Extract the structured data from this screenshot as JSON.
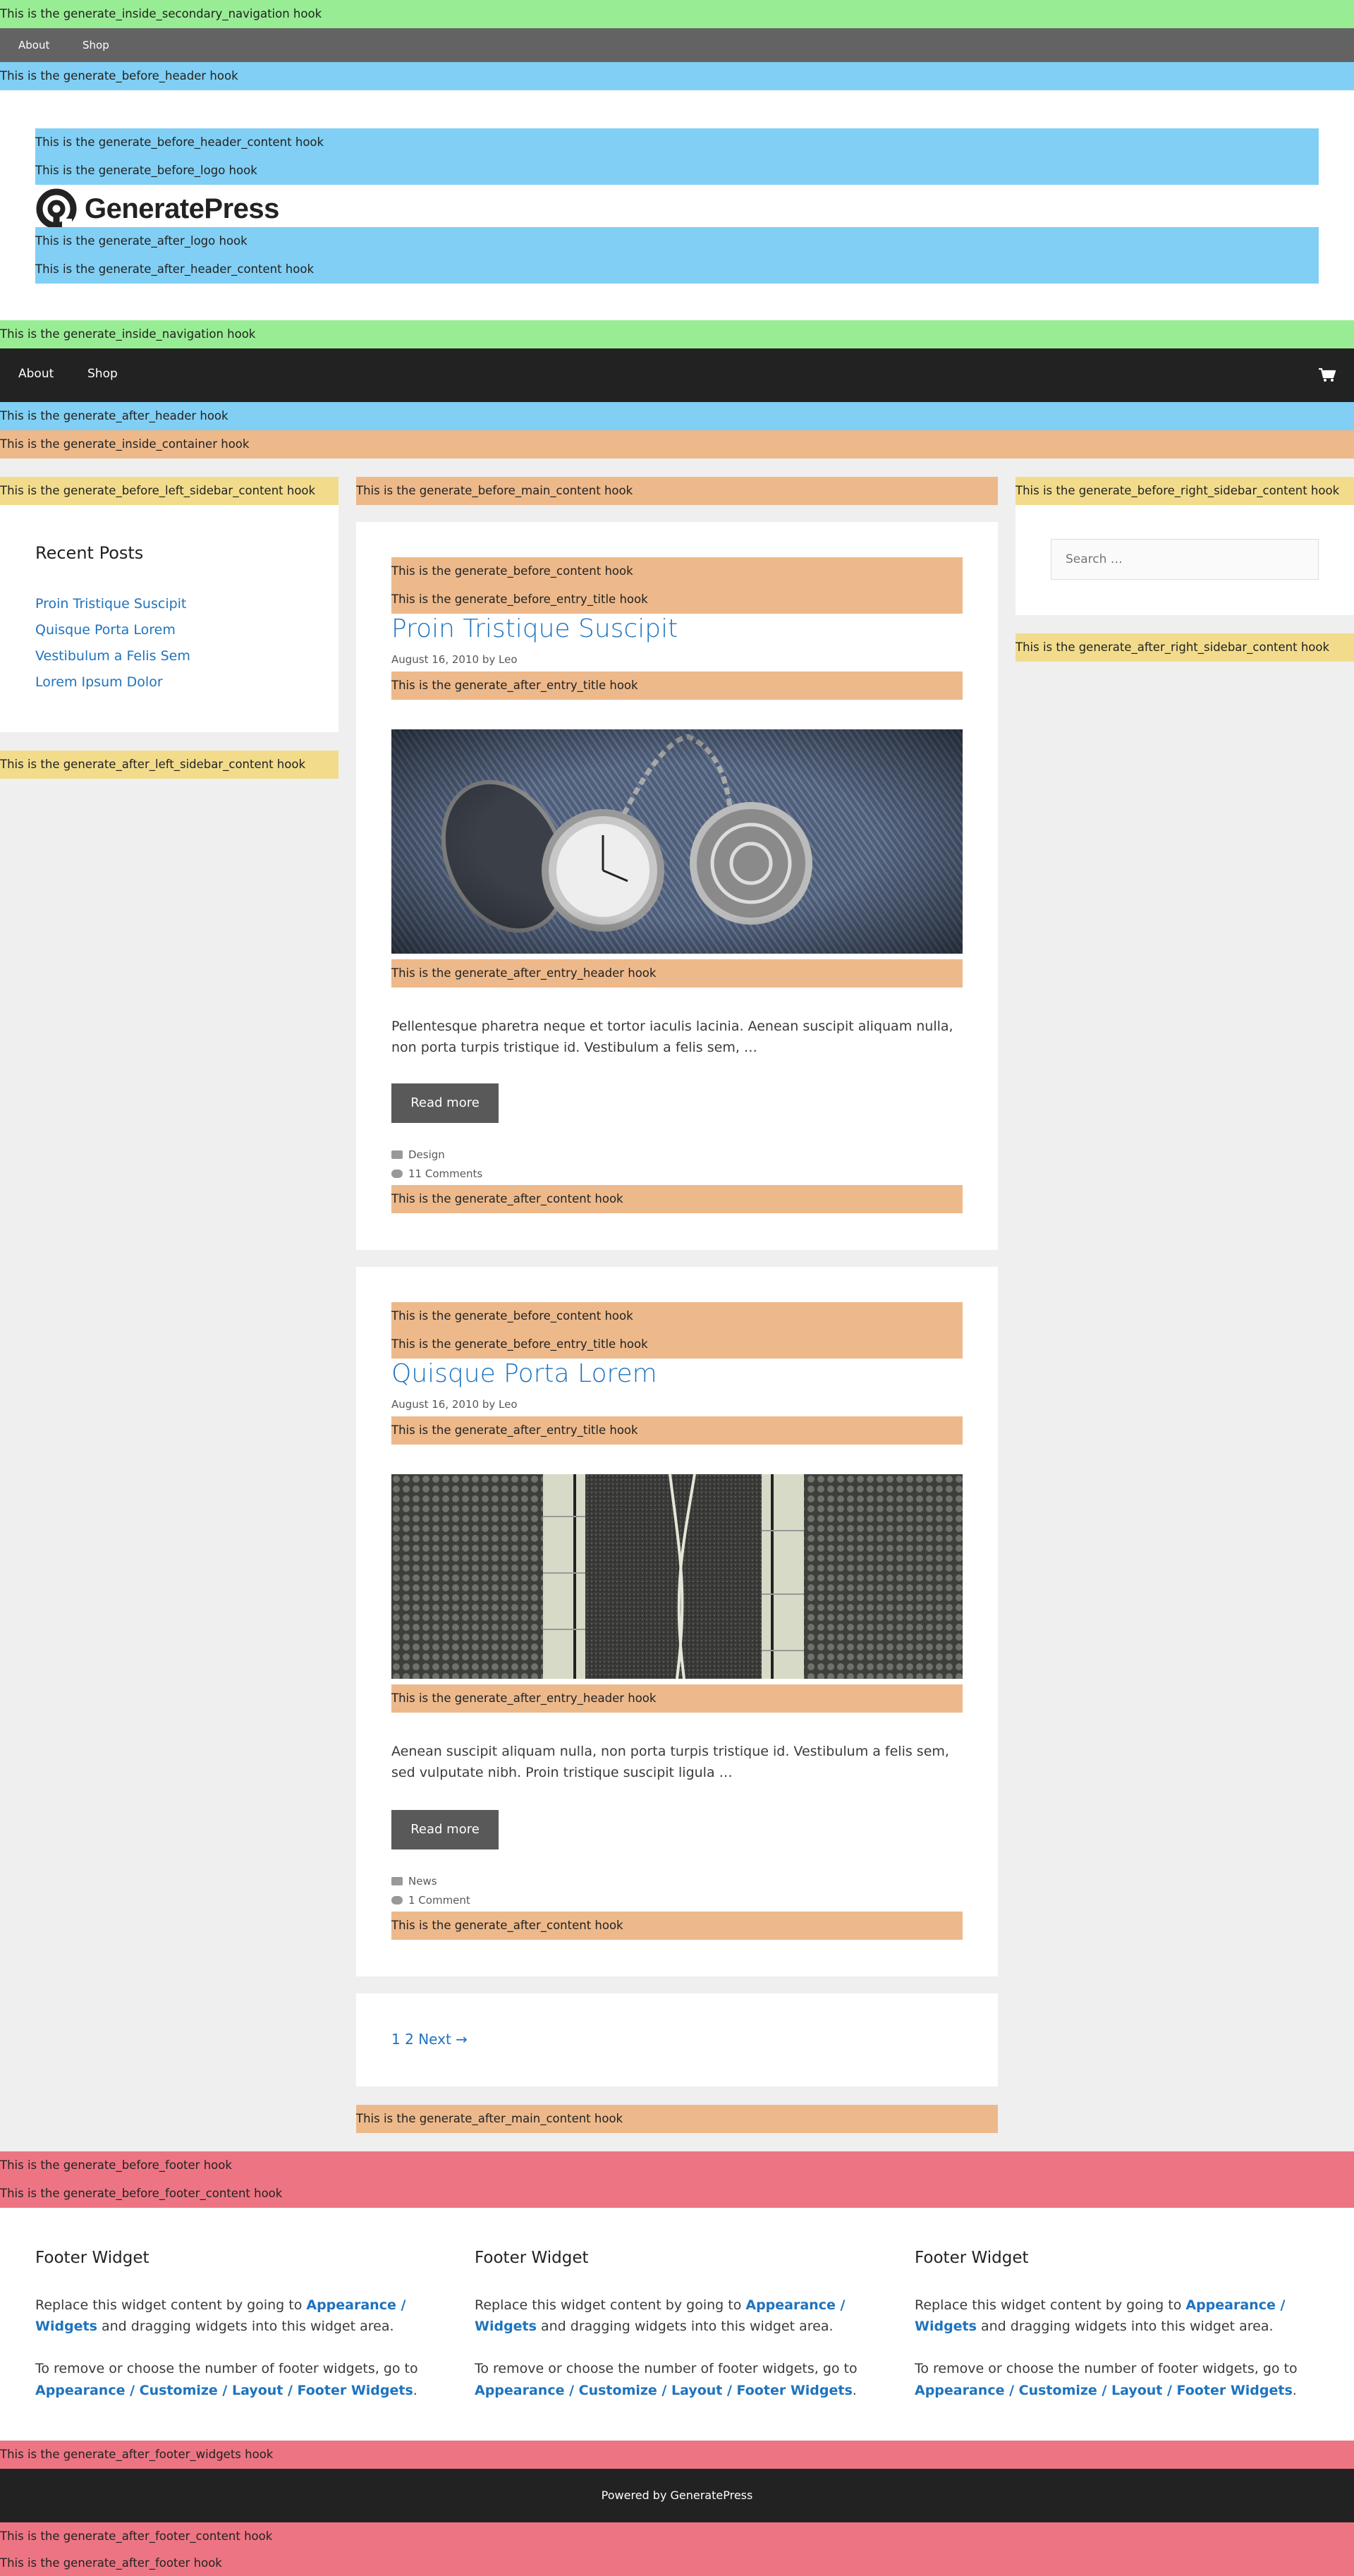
{
  "hooks": {
    "inside_secondary_navigation": "This is the generate_inside_secondary_navigation hook",
    "before_header": "This is the generate_before_header hook",
    "before_header_content": "This is the generate_before_header_content hook",
    "before_logo": "This is the generate_before_logo hook",
    "after_logo": "This is the generate_after_logo hook",
    "after_header_content": "This is the generate_after_header_content hook",
    "inside_navigation": "This is the generate_inside_navigation hook",
    "after_header": "This is the generate_after_header hook",
    "inside_container": "This is the generate_inside_container hook",
    "before_left_sidebar_content": "This is the generate_before_left_sidebar_content hook",
    "after_left_sidebar_content": "This is the generate_after_left_sidebar_content hook",
    "before_main_content": "This is the generate_before_main_content hook",
    "before_right_sidebar_content": "This is the generate_before_right_sidebar_content hook",
    "after_right_sidebar_content": "This is the generate_after_right_sidebar_content hook",
    "before_content": "This is the generate_before_content hook",
    "before_entry_title": "This is the generate_before_entry_title hook",
    "after_entry_title": "This is the generate_after_entry_title hook",
    "after_entry_header": "This is the generate_after_entry_header hook",
    "after_content": "This is the generate_after_content hook",
    "after_main_content": "This is the generate_after_main_content hook",
    "before_footer": "This is the generate_before_footer hook",
    "before_footer_content": "This is the generate_before_footer_content hook",
    "after_footer_widgets": "This is the generate_after_footer_widgets hook",
    "after_footer_content": "This is the generate_after_footer_content hook",
    "after_footer": "This is the generate_after_footer hook"
  },
  "secondary_nav": {
    "items": [
      "About",
      "Shop"
    ]
  },
  "logo": {
    "text": "GeneratePress"
  },
  "main_nav": {
    "items": [
      "About",
      "Shop"
    ],
    "cart_icon": "cart-icon"
  },
  "left_sidebar": {
    "title": "Recent Posts",
    "posts": [
      "Proin Tristique Suscipit",
      "Quisque Porta Lorem",
      "Vestibulum a Felis Sem",
      "Lorem Ipsum Dolor"
    ]
  },
  "right_sidebar": {
    "search_placeholder": "Search …"
  },
  "posts": [
    {
      "title": "Proin Tristique Suscipit",
      "date": "August 16, 2010",
      "by": "by",
      "author": "Leo",
      "excerpt": "Pellentesque pharetra neque et tortor iaculis lacinia. Aenean suscipit aliquam nulla, non porta turpis tristique id. Vestibulum a felis sem, …",
      "read_more": "Read more",
      "category": "Design",
      "comments": "11 Comments"
    },
    {
      "title": "Quisque Porta Lorem",
      "date": "August 16, 2010",
      "by": "by",
      "author": "Leo",
      "excerpt": "Aenean suscipit aliquam nulla, non porta turpis tristique id. Vestibulum a felis sem, sed vulputate nibh. Proin tristique suscipit ligula …",
      "read_more": "Read more",
      "category": "News",
      "comments": "1 Comment"
    }
  ],
  "pagination": {
    "page1": "1",
    "page2": "2",
    "next": "Next →"
  },
  "footer_widget": {
    "title": "Footer Widget",
    "p1_pre": "Replace this widget content by going to ",
    "p1_link": "Appearance / Widgets",
    "p1_post": " and dragging widgets into this widget area.",
    "p2_pre": "To remove or choose the number of footer widgets, go to ",
    "p2_link": "Appearance / Customize / Layout / Footer Widgets",
    "p2_post": "."
  },
  "footer": {
    "powered_by": "Powered by GeneratePress"
  },
  "colors": {
    "accent": "#1e73be",
    "hook_green": "#98ed94",
    "hook_blue": "#81cff4",
    "hook_orange": "#edb98b",
    "hook_yellow": "#f2dc8c",
    "hook_pink": "#ed7583"
  }
}
